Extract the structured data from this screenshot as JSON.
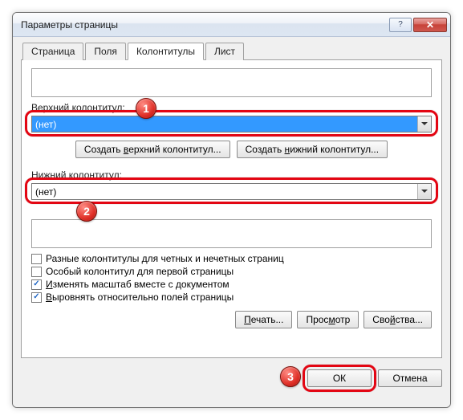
{
  "window": {
    "title": "Параметры страницы"
  },
  "tabs": {
    "page": "Страница",
    "fields": "Поля",
    "headers": "Колонтитулы",
    "sheet": "Лист"
  },
  "header_section": {
    "label": "Верхний колонтитул:",
    "value": "(нет)"
  },
  "footer_section": {
    "label": "Нижний колонтитул:",
    "value": "(нет)"
  },
  "buttons": {
    "create_header": "Создать верхний колонтитул...",
    "create_footer": "Создать нижний колонтитул...",
    "print": "Печать...",
    "preview": "Просмотр",
    "properties": "Свойства...",
    "ok": "ОК",
    "cancel": "Отмена"
  },
  "checkboxes": {
    "odd_even": {
      "label": "Разные колонтитулы для четных и нечетных страниц",
      "checked": false
    },
    "first_page": {
      "label": "Особый колонтитул для первой страницы",
      "checked": false
    },
    "scale": {
      "label": "Изменять масштаб вместе с документом",
      "checked": true
    },
    "align": {
      "label": "Выровнять относительно полей страницы",
      "checked": true
    }
  },
  "markers": {
    "m1": "1",
    "m2": "2",
    "m3": "3"
  }
}
